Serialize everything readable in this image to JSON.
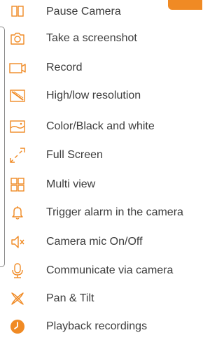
{
  "accent_color": "#f08a24",
  "items": [
    {
      "icon": "pause-icon",
      "label": "Pause Camera"
    },
    {
      "icon": "camera-icon",
      "label": "Take a screenshot"
    },
    {
      "icon": "video-record-icon",
      "label": "Record"
    },
    {
      "icon": "resolution-icon",
      "label": "High/low resolution"
    },
    {
      "icon": "color-mode-icon",
      "label": "Color/Black and white"
    },
    {
      "icon": "fullscreen-icon",
      "label": "Full Screen"
    },
    {
      "icon": "grid-icon",
      "label": "Multi view"
    },
    {
      "icon": "bell-icon",
      "label": "Trigger alarm in the camera"
    },
    {
      "icon": "speaker-mute-icon",
      "label": "Camera mic On/Off"
    },
    {
      "icon": "microphone-icon",
      "label": "Communicate via camera"
    },
    {
      "icon": "pan-tilt-icon",
      "label": "Pan  & Tilt"
    },
    {
      "icon": "playback-icon",
      "label": "Playback recordings"
    }
  ]
}
